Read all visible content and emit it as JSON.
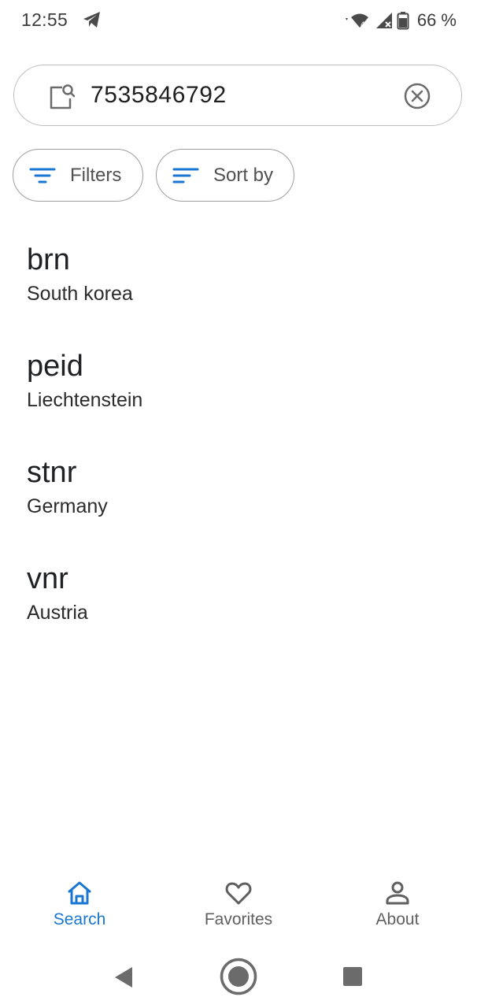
{
  "status_bar": {
    "time": "12:55",
    "battery_percent": "66 %",
    "icons": [
      "telegram-icon",
      "wifi-icon",
      "signal-icon",
      "battery-icon"
    ]
  },
  "search": {
    "value": "7535846792",
    "lead_icon": "document-search-icon",
    "clear_icon": "clear-circle-icon"
  },
  "chips": {
    "filters_label": "Filters",
    "sort_label": "Sort by"
  },
  "results": [
    {
      "title": "brn",
      "subtitle": "South korea"
    },
    {
      "title": "peid",
      "subtitle": "Liechtenstein"
    },
    {
      "title": "stnr",
      "subtitle": "Germany"
    },
    {
      "title": "vnr",
      "subtitle": "Austria"
    }
  ],
  "bottom_nav": {
    "items": [
      {
        "label": "Search",
        "icon": "home-icon",
        "active": true
      },
      {
        "label": "Favorites",
        "icon": "heart-icon",
        "active": false
      },
      {
        "label": "About",
        "icon": "person-icon",
        "active": false
      }
    ]
  },
  "colors": {
    "accent": "#1976d2",
    "text_primary": "#202124",
    "text_secondary": "#5f5f5f",
    "outline": "#bdbdbd"
  }
}
